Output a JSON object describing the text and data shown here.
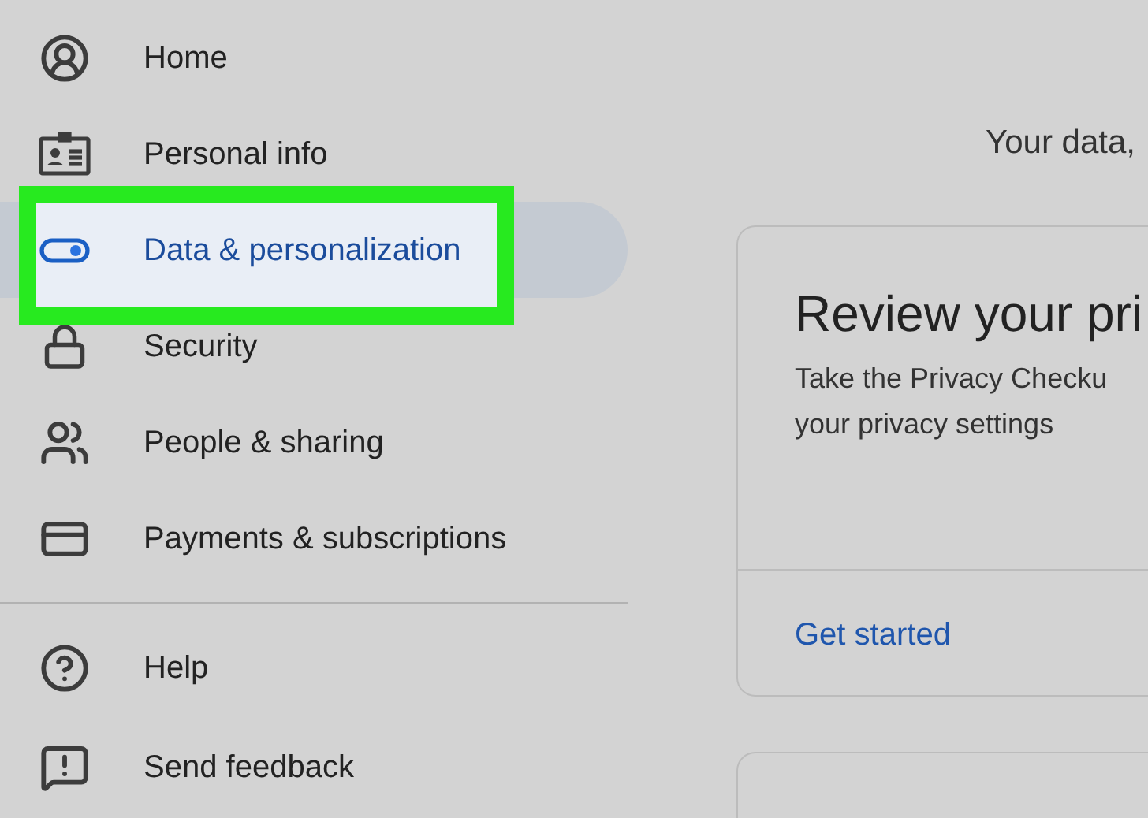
{
  "sidebar": {
    "items": [
      {
        "kind": "home",
        "label": "Home",
        "selected": false,
        "highlighted": false
      },
      {
        "kind": "person-card",
        "label": "Personal info",
        "selected": false,
        "highlighted": false
      },
      {
        "kind": "toggle",
        "label": "Data & personalization",
        "selected": true,
        "highlighted": true
      },
      {
        "kind": "lock",
        "label": "Security",
        "selected": false,
        "highlighted": false
      },
      {
        "kind": "people",
        "label": "People & sharing",
        "selected": false,
        "highlighted": false
      },
      {
        "kind": "card",
        "label": "Payments & subscriptions",
        "selected": false,
        "highlighted": false
      }
    ],
    "footer_items": [
      {
        "kind": "help",
        "label": "Help"
      },
      {
        "kind": "feedback",
        "label": "Send feedback"
      }
    ]
  },
  "main": {
    "heading": "Your data,",
    "cards": [
      {
        "title": "Review your pri",
        "description": "Take the Privacy Checku",
        "description_line_2": "your privacy settings",
        "action": "Get started"
      }
    ]
  }
}
